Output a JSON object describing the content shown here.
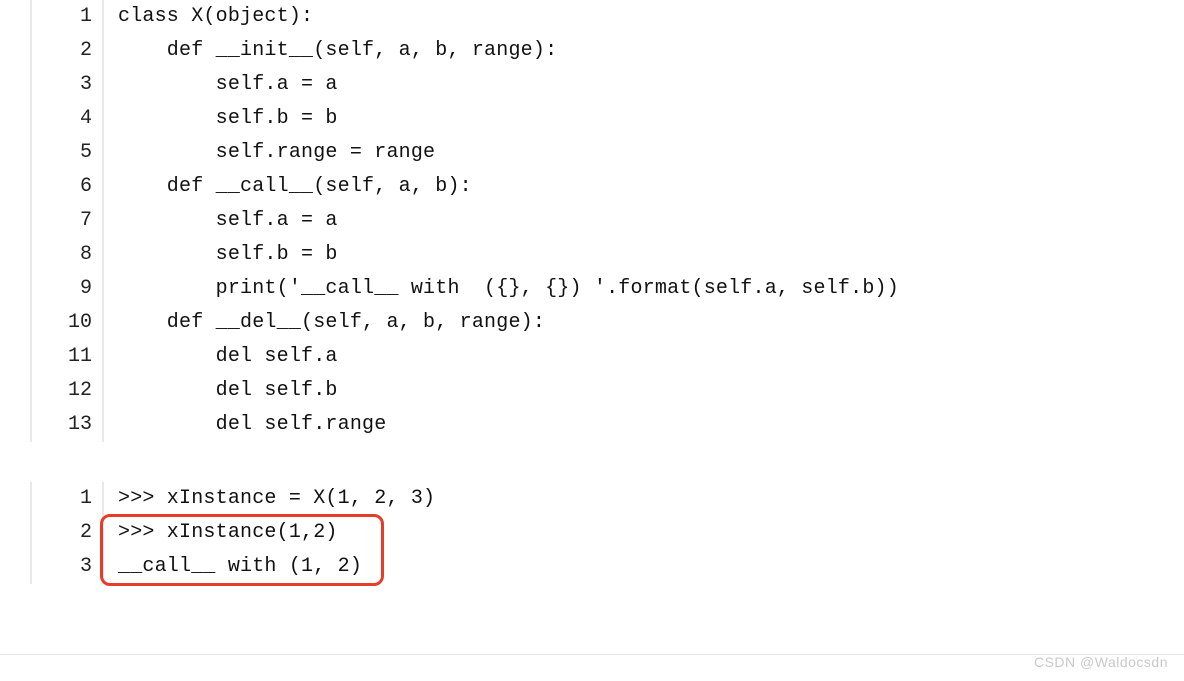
{
  "block_a": {
    "lines": [
      {
        "n": "1",
        "code": "class X(object):"
      },
      {
        "n": "2",
        "code": "    def __init__(self, a, b, range):"
      },
      {
        "n": "3",
        "code": "        self.a = a"
      },
      {
        "n": "4",
        "code": "        self.b = b"
      },
      {
        "n": "5",
        "code": "        self.range = range"
      },
      {
        "n": "6",
        "code": "    def __call__(self, a, b):"
      },
      {
        "n": "7",
        "code": "        self.a = a"
      },
      {
        "n": "8",
        "code": "        self.b = b"
      },
      {
        "n": "9",
        "code": "        print('__call__ with  ({}, {}) '.format(self.a, self.b))"
      },
      {
        "n": "10",
        "code": "    def __del__(self, a, b, range):"
      },
      {
        "n": "11",
        "code": "        del self.a"
      },
      {
        "n": "12",
        "code": "        del self.b"
      },
      {
        "n": "13",
        "code": "        del self.range"
      }
    ]
  },
  "block_b": {
    "lines": [
      {
        "n": "1",
        "code": ">>> xInstance = X(1, 2, 3)"
      },
      {
        "n": "2",
        "code": ">>> xInstance(1,2)"
      },
      {
        "n": "3",
        "code": "__call__ with (1, 2) "
      }
    ]
  },
  "watermark": "CSDN @Waldocsdn"
}
